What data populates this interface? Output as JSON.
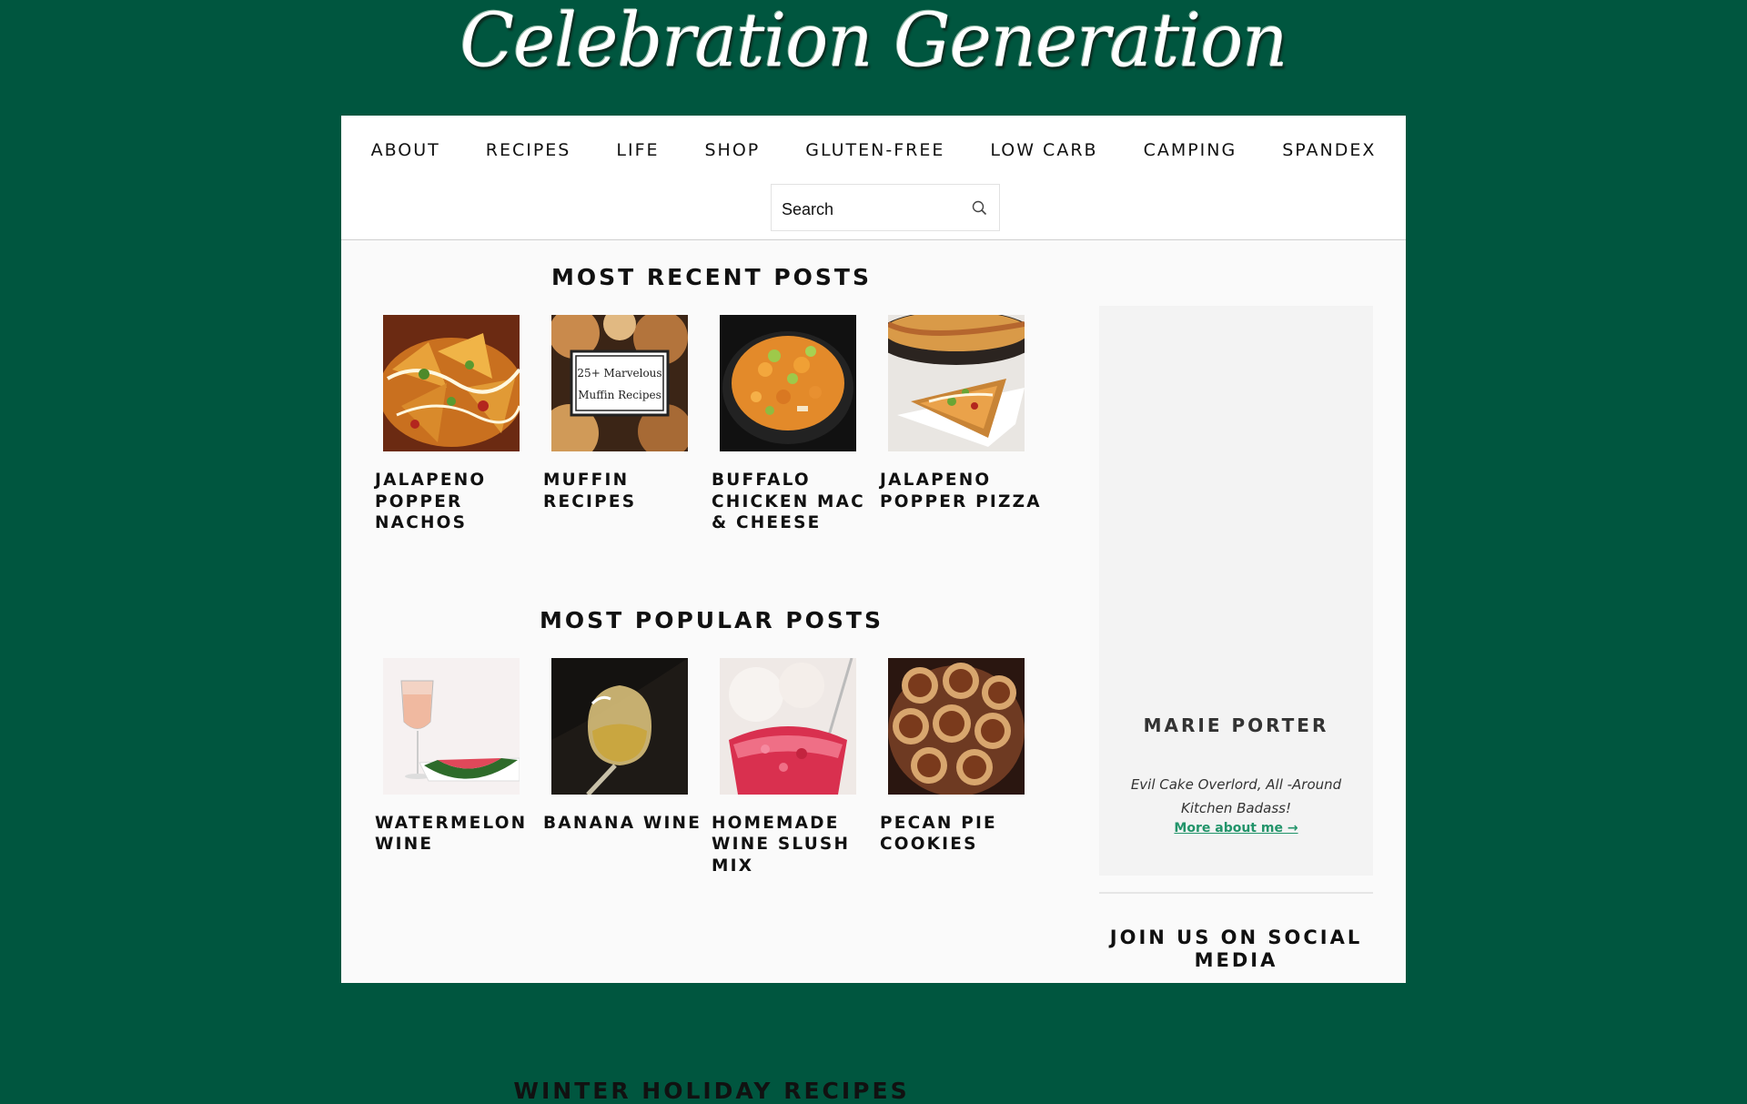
{
  "header": {
    "site_title": "Celebration Generation"
  },
  "nav": {
    "items": [
      "ABOUT",
      "RECIPES",
      "LIFE",
      "SHOP",
      "GLUTEN-FREE",
      "LOW CARB",
      "CAMPING",
      "SPANDEX"
    ],
    "search_placeholder": "Search"
  },
  "recent": {
    "title": "MOST RECENT POSTS",
    "posts": [
      {
        "title": "JALAPENO POPPER NACHOS"
      },
      {
        "title": "MUFFIN RECIPES",
        "image_text": [
          "25+ Marvelous",
          "Muffin Recipes"
        ]
      },
      {
        "title": "BUFFALO CHICKEN MAC & CHEESE"
      },
      {
        "title": "JALAPENO POPPER PIZZA"
      }
    ]
  },
  "popular": {
    "title": "MOST POPULAR POSTS",
    "posts": [
      {
        "title": "WATERMELON WINE"
      },
      {
        "title": "BANANA WINE"
      },
      {
        "title": "HOMEMADE WINE SLUSH MIX"
      },
      {
        "title": "PECAN PIE COOKIES"
      }
    ]
  },
  "next_section": {
    "title": "WINTER HOLIDAY RECIPES"
  },
  "sidebar": {
    "author_name": "MARIE PORTER",
    "author_bio": "Evil Cake Overlord, All -Around Kitchen Badass!",
    "more_link": "More about me →",
    "social_title": "JOIN US ON SOCIAL MEDIA"
  },
  "colors": {
    "background": "#00563f",
    "link": "#22946a",
    "content_bg": "#fafafa"
  }
}
